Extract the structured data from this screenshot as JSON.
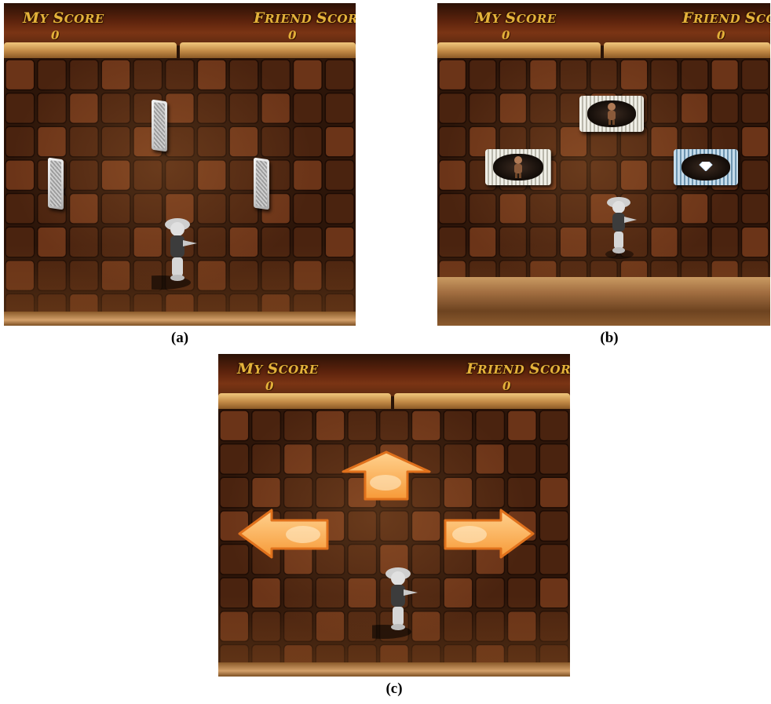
{
  "hud": {
    "my_score_label": "MY SCORE",
    "friend_score_label": "FRIEND SCORE",
    "my_score_value": "0",
    "friend_score_value": "0"
  },
  "captions": {
    "a": "(a)",
    "b": "(b)",
    "c": "(c)"
  },
  "panels": {
    "a": {
      "cards": [
        "standing",
        "standing",
        "standing"
      ]
    },
    "b": {
      "cards": [
        "character",
        "character",
        "diamond"
      ]
    },
    "c": {
      "arrows": [
        "up",
        "left",
        "right"
      ]
    }
  },
  "colors": {
    "hud_text": "#e4b23a",
    "tile": "#4a230f",
    "tile_highlight": "#6b3418",
    "arrow_fill": "#f7a54a",
    "arrow_stroke": "#e0711c"
  }
}
